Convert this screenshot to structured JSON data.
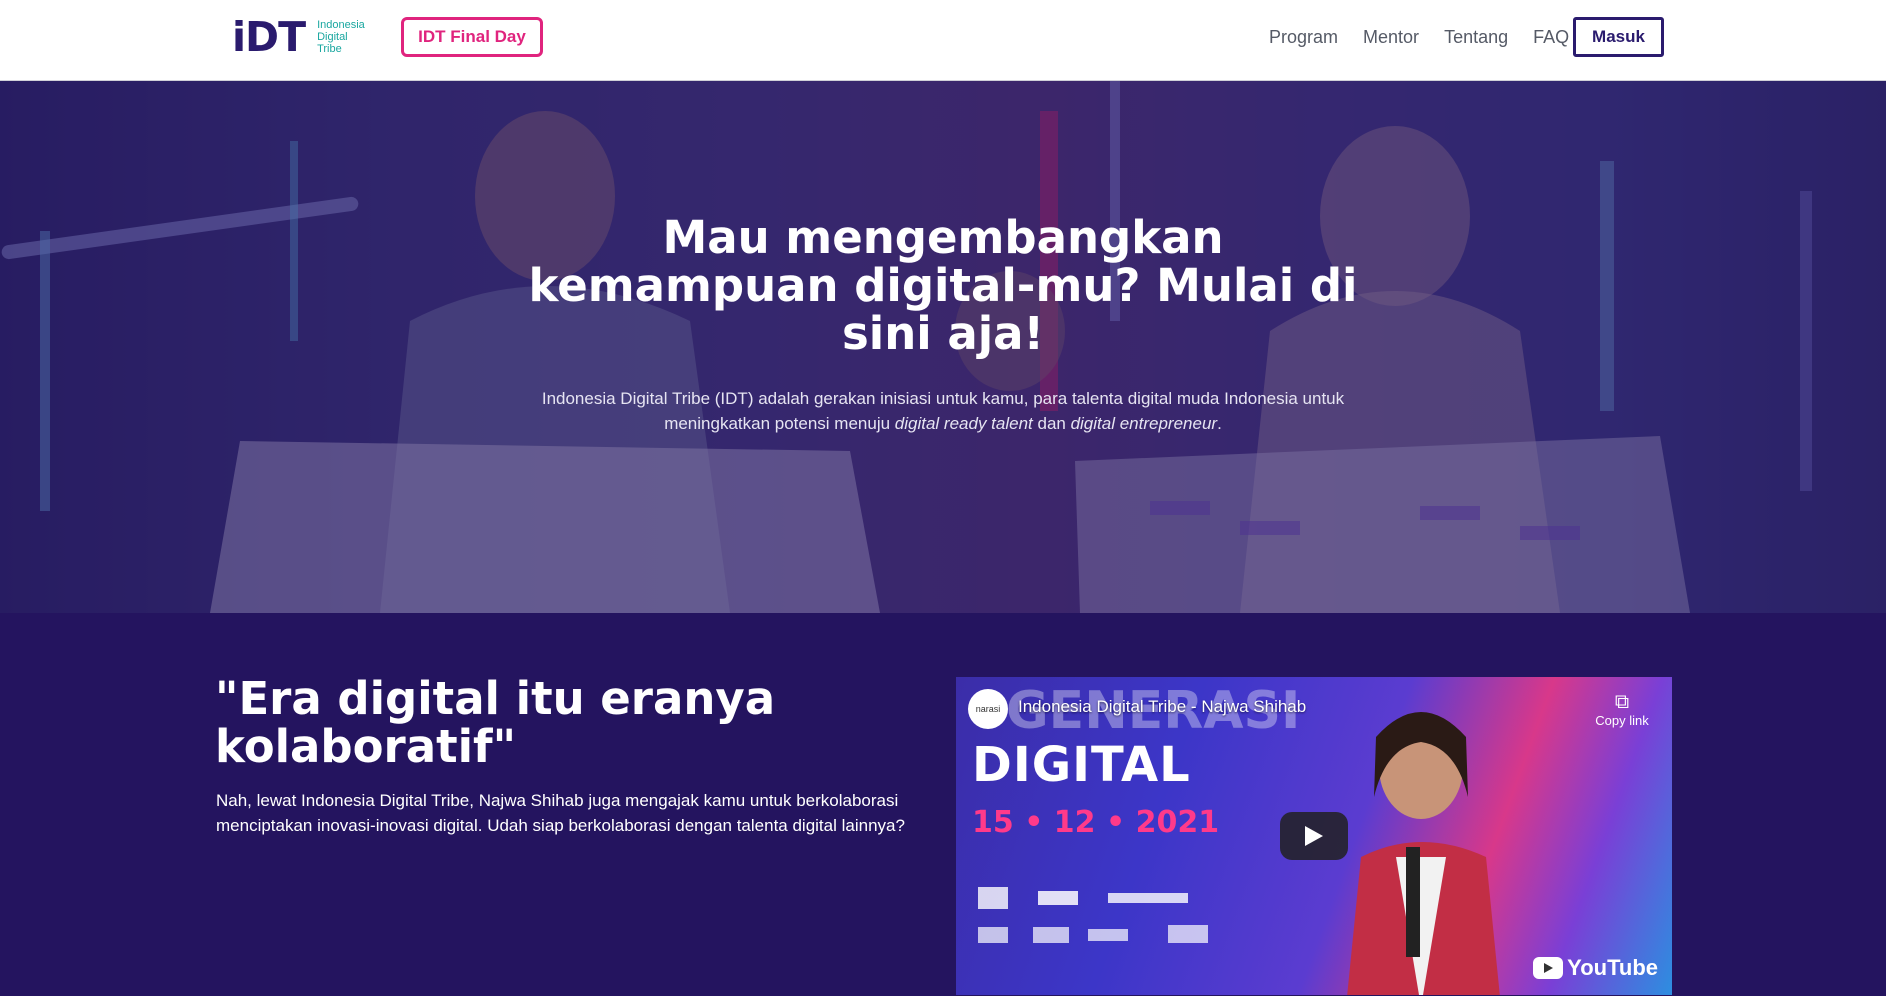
{
  "navbar": {
    "logo_mark": "iDT",
    "logo_lines": [
      "Indonesia",
      "Digital",
      "Tribe"
    ],
    "final_day_label": "IDT Final Day",
    "links": [
      "Program",
      "Mentor",
      "Tentang",
      "FAQ"
    ],
    "masuk_label": "Masuk"
  },
  "hero": {
    "title_lines": [
      "Mau mengembangkan",
      "kemampuan digital-mu? Mulai di",
      "sini aja!"
    ],
    "desc_line1": "Indonesia Digital Tribe (IDT) adalah gerakan inisiasi untuk kamu, para talenta digital muda Indonesia untuk",
    "desc_line2_prefix": "meningkatkan potensi menuju ",
    "desc_em1": "digital ready talent",
    "desc_mid": " dan ",
    "desc_em2": "digital entrepreneur",
    "desc_suffix": "."
  },
  "section2": {
    "quote_lines": [
      "\"Era digital itu eranya",
      "kolaboratif\""
    ],
    "desc_line1": "Nah, lewat Indonesia Digital Tribe, Najwa Shihab juga mengajak kamu untuk berkolaborasi",
    "desc_line2": "menciptakan inovasi-inovasi digital. Udah siap berkolaborasi dengan talenta digital lainnya?"
  },
  "video": {
    "channel": "narasi",
    "title": "Indonesia Digital Tribe - Najwa Shihab",
    "copy_link": "Copy link",
    "bg_generasi": "GENERASI",
    "bg_digital": "DIGITAL",
    "bg_date": "15 • 12 • 2021",
    "youtube": "YouTube"
  },
  "colors": {
    "brand_dark": "#2a1b6e",
    "accent_pink": "#e0247e",
    "section_bg": "#24145f",
    "logo_teal": "#1aa7a0"
  }
}
